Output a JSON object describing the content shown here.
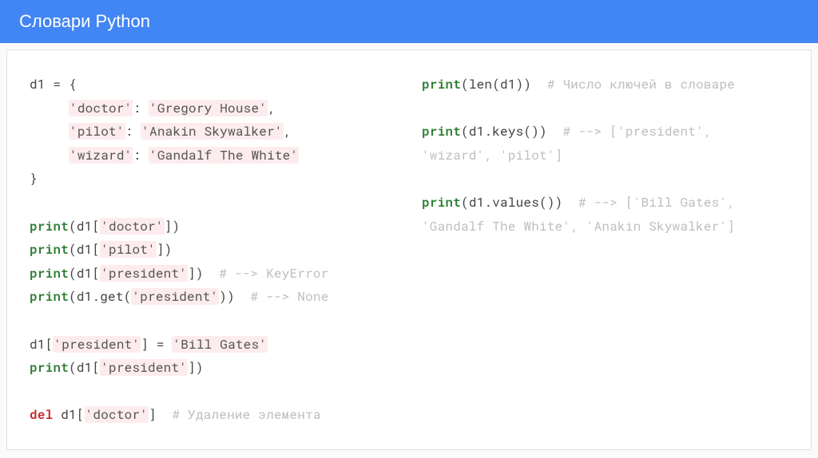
{
  "header": {
    "title": "Словари Python"
  },
  "left": {
    "l1": "d1 = {",
    "l2a": "     ",
    "l2s": "'doctor'",
    "l2b": ": ",
    "l2s2": "'Gregory House'",
    "l2c": ",",
    "l3a": "     ",
    "l3s": "'pilot'",
    "l3b": ": ",
    "l3s2": "'Anakin Skywalker'",
    "l3c": ",",
    "l4a": "     ",
    "l4s": "'wizard'",
    "l4b": ": ",
    "l4s2": "'Gandalf The White'",
    "l5": "}",
    "l6kw": "print",
    "l6a": "(d1[",
    "l6s": "'doctor'",
    "l6b": "])",
    "l7kw": "print",
    "l7a": "(d1[",
    "l7s": "'pilot'",
    "l7b": "])",
    "l8kw": "print",
    "l8a": "(d1[",
    "l8s": "'president'",
    "l8b": "])  ",
    "l8c": "# --> KeyError",
    "l9kw": "print",
    "l9a": "(d1.get(",
    "l9s": "'president'",
    "l9b": "))  ",
    "l9c": "# --> None",
    "l10a": "d1[",
    "l10s": "'president'",
    "l10b": "] = ",
    "l10s2": "'Bill Gates'",
    "l11kw": "print",
    "l11a": "(d1[",
    "l11s": "'president'",
    "l11b": "])",
    "l12kw": "del",
    "l12a": " d1[",
    "l12s": "'doctor'",
    "l12b": "]  ",
    "l12c": "# Удаление элемента"
  },
  "right": {
    "r1kw": "print",
    "r1a": "(len(d1))  ",
    "r1c": "# Число ключей в словаре",
    "r2kw": "print",
    "r2a": "(d1.keys())  ",
    "r2c": "# --> ['president', 'wizard', 'pilot']",
    "r3kw": "print",
    "r3a": "(d1.values())  ",
    "r3c": "# --> ['Bill Gates', 'Gandalf The White', 'Anakin Skywalker']"
  }
}
